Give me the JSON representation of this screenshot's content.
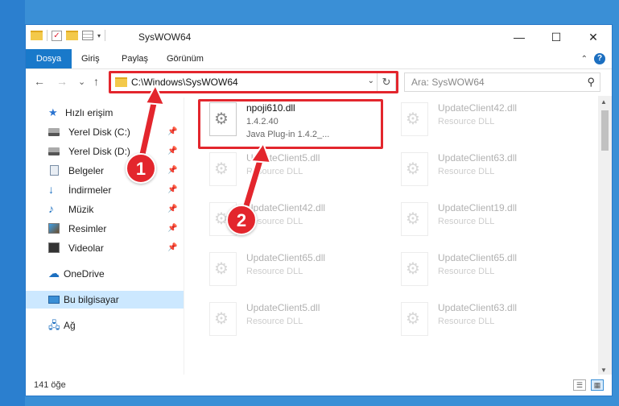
{
  "window": {
    "title": "SysWOW64",
    "minimize_glyph": "—",
    "maximize_glyph": "☐",
    "close_glyph": "✕"
  },
  "ribbon": {
    "tabs": [
      "Dosya",
      "Giriş",
      "Paylaş",
      "Görünüm"
    ],
    "help_glyph": "?",
    "collapse_glyph": "⌃"
  },
  "nav": {
    "back_glyph": "←",
    "forward_glyph": "→",
    "recent_glyph": "⌄",
    "up_glyph": "↑",
    "address": "C:\\Windows\\SysWOW64",
    "refresh_glyph": "↻",
    "search_placeholder": "Ara: SysWOW64",
    "search_glyph": "⚲"
  },
  "sidebar": {
    "items": [
      {
        "label": "Hızlı erişim",
        "icon": "star-icon"
      },
      {
        "label": "Yerel Disk (C:)",
        "icon": "disk-icon",
        "pinned": true
      },
      {
        "label": "Yerel Disk (D:)",
        "icon": "disk-icon",
        "pinned": true
      },
      {
        "label": "Belgeler",
        "icon": "documents-icon",
        "pinned": true
      },
      {
        "label": "İndirmeler",
        "icon": "download-icon",
        "pinned": true
      },
      {
        "label": "Müzik",
        "icon": "music-icon",
        "pinned": true
      },
      {
        "label": "Resimler",
        "icon": "pictures-icon",
        "pinned": true
      },
      {
        "label": "Videolar",
        "icon": "videos-icon",
        "pinned": true
      },
      {
        "label": "OneDrive",
        "icon": "cloud-icon"
      },
      {
        "label": "Bu bilgisayar",
        "icon": "computer-icon",
        "selected": true
      },
      {
        "label": "Ağ",
        "icon": "network-icon"
      }
    ],
    "pin_glyph": "📌"
  },
  "files": [
    {
      "name": "npoji610.dll",
      "line2": "1.4.2.40",
      "line3": "Java Plug-in 1.4.2_...",
      "highlight": true
    },
    {
      "name": "UpdateClient42.dll",
      "line2": "Resource DLL"
    },
    {
      "name": "UpdateClient5.dll",
      "line2": "Resource DLL"
    },
    {
      "name": "UpdateClient63.dll",
      "line2": "Resource DLL"
    },
    {
      "name": "UpdateClient42.dll",
      "line2": "Resource DLL"
    },
    {
      "name": "UpdateClient19.dll",
      "line2": "Resource DLL"
    },
    {
      "name": "UpdateClient65.dll",
      "line2": "Resource DLL"
    },
    {
      "name": "UpdateClient65.dll",
      "line2": "Resource DLL"
    },
    {
      "name": "UpdateClient5.dll",
      "line2": "Resource DLL"
    },
    {
      "name": "UpdateClient63.dll",
      "line2": "Resource DLL"
    }
  ],
  "status": {
    "count": "141 öğe"
  },
  "annotations": {
    "step1": "1",
    "step2": "2",
    "color": "#e3262d"
  }
}
